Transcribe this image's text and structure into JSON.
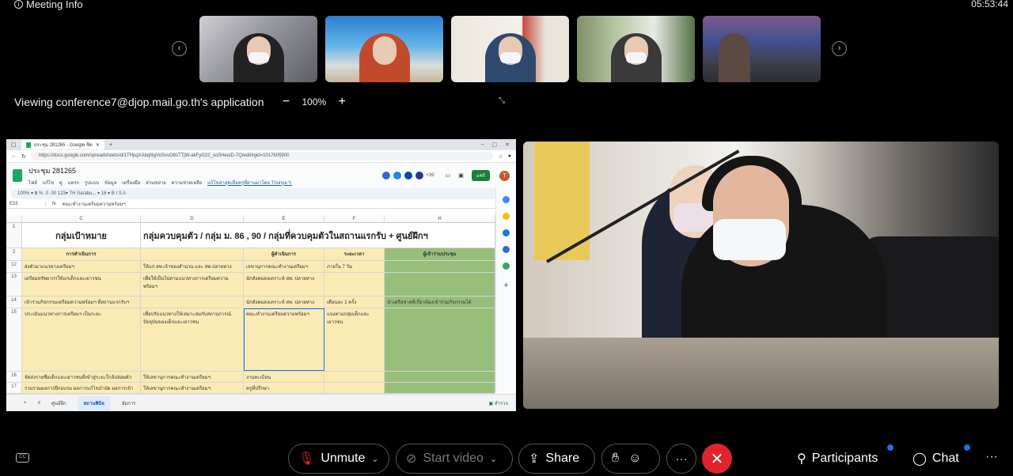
{
  "meeting_info_label": "Meeting Info",
  "clock": "05:53:44",
  "viewing": {
    "text": "Viewing conference7@djop.mail.go.th's application",
    "zoom": "100%",
    "zoom_out": "−",
    "zoom_in": "+"
  },
  "filmstrip": {
    "prev": "‹",
    "next": "›"
  },
  "shared_sheet": {
    "browser_tab_title": "ประชุม 281265 - Google ชีต",
    "url": "https://docs.google.com/spreadsheets/d/1THpqXAbqNgVoSvvO8sTTjW-akFyG22_soSHeoiD-7Q/edit#gid=1017605900",
    "doc_title": "ประชุม 281265",
    "menu": [
      "ไฟล์",
      "แก้ไข",
      "ดู",
      "แทรก",
      "รูปแบบ",
      "ข้อมูล",
      "เครื่องมือ",
      "ส่วนขยาย",
      "ความช่วยเหลือ"
    ],
    "last_edit": "แก้ไขล่าสุดเมื่อครู่ที่ผ่านมาโดย Thunya Y.",
    "share_label": "แชร์",
    "user_initial": "T",
    "participants_count": "+39",
    "toolbar_text": "100% ▾  ฿  %  .0  .00  123▾  TH Sarabu... ▾  16  ▾  B  I  S  A",
    "cell_ref": "E15",
    "fx": "fx",
    "formula_value": "คณะทำงานเตรียมความพร้อมฯ",
    "columns": [
      "C",
      "D",
      "E",
      "F",
      "",
      "H"
    ],
    "title_row": {
      "num": "1",
      "c": "กลุ่มเป้าหมาย",
      "rest": "กลุ่มควบคุมตัว / กลุ่ม ม. 86 , 90 / กลุ่มที่ควบคุมตัวในสถานแรกรับ + ศูนย์ฝึกฯ"
    },
    "header_row": {
      "num": "2",
      "c": "การดำเนินการ",
      "d": "",
      "e": "ผู้ดำเนินการ",
      "f": "ระยะเวลา",
      "h": "ผู้เข้าร่วมประชุม"
    },
    "rows": [
      {
        "num": "12",
        "c": "ส่งตัวมาแนวทางเตรียมฯ",
        "d": "ให้แก่ สพ.เจ้าของสำนวน และ สพ.ปลายทาง",
        "e": "เลขานุการคณะทำงานเตรียมฯ",
        "f": "ภายใน 7 วัน",
        "h": ""
      },
      {
        "num": "13",
        "c": "เตรียมทรัพยากรให้แก่เด็กและเยาวชน",
        "d": "เพื่อให้เป็นไปตามแนวทางการเตรียมความพร้อมฯ",
        "e": "นักสังคมสงเคราะห์ สพ. ปลายทาง",
        "f": "",
        "h": ""
      },
      {
        "num": "14",
        "c": "เข้าร่วมกิจกรรมเตรียมความพร้อมฯ ที่สถานแรกรับฯ",
        "d": "",
        "e": "นักสังคมสงเคราะห์ สพ. ปลายทาง",
        "f": "เดือนละ 1 ครั้ง",
        "h": "นำเครือข่ายที่เกี่ยวข้องเข้าร่วมกิจกรรมได้"
      },
      {
        "num": "15",
        "c": "ประเมินแนวทางการเตรียมฯ เป็นระยะ",
        "d": "เพื่อปรับแนวทางให้เหมาะสมกับสถานการณ์ปัจจุบันของเด็กและเยาวชน",
        "e": "คณะทำงานเตรียมความพร้อมฯ",
        "f": "แบ่งตามกลุ่มเด็กและเยาวชน",
        "h": ""
      },
      {
        "num": "16",
        "c": "จัดส่งรายชื่อเด็กและเยาวชนที่เข้าสู่ระยะใกล้ปล่อยตัว",
        "d": "ให้เลขานุการคณะทำงานเตรียมฯ",
        "e": "งานทะเบียน",
        "f": "",
        "h": ""
      },
      {
        "num": "17",
        "c": "รวบรวมผลการฝึกอบรม ผลการแก้ไขบำบัด ผลการเข้า",
        "d": "ให้เลขานุการคณะทำงานเตรียมฯ",
        "e": "ครูที่ปรึกษา",
        "f": "",
        "h": ""
      }
    ],
    "sheet_tabs": [
      "ศูนย์ฝึก",
      "สถานพินิจ",
      "อัยการ"
    ],
    "active_tab_index": 1,
    "explore_label": "สำรวจ"
  },
  "controls": {
    "unmute": "Unmute",
    "start_video": "Start video",
    "share": "Share",
    "more": "···",
    "leave": "✕",
    "participants": "Participants",
    "chat": "Chat",
    "overflow": "···",
    "cc": "CC"
  },
  "colors": {
    "leave_red": "#e0242b",
    "sheet_yellow": "#faebb4",
    "sheet_green": "#98be7b",
    "notification_blue": "#1f6fe0"
  }
}
